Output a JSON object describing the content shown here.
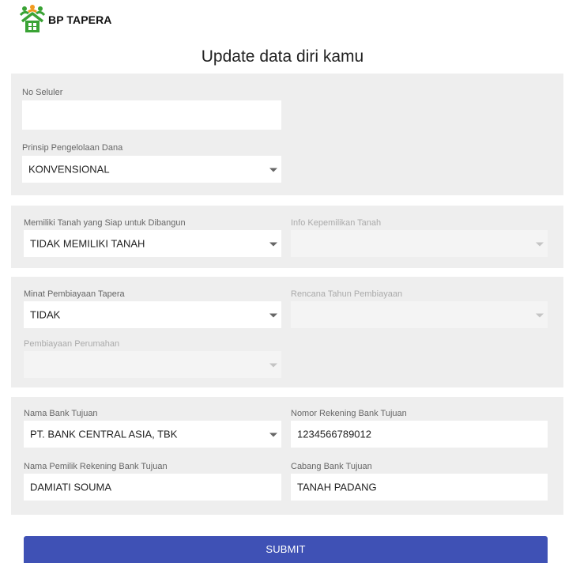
{
  "app": {
    "brand": "BP TAPERA",
    "logo_icon": "house-people-icon",
    "accent_green": "#3aa335",
    "accent_orange": "#f29a1f"
  },
  "page": {
    "title": "Update data diri kamu"
  },
  "section1": {
    "phone": {
      "label": "No Seluler",
      "value": ""
    },
    "fund_principle": {
      "label": "Prinsip Pengelolaan Dana",
      "value": "KONVENSIONAL"
    }
  },
  "section2": {
    "land_ready": {
      "label": "Memiliki Tanah yang Siap untuk Dibangun",
      "value": "TIDAK MEMILIKI TANAH"
    },
    "land_info": {
      "label": "Info Kepemilikan Tanah",
      "value": ""
    }
  },
  "section3": {
    "financing_interest": {
      "label": "Minat Pembiayaan Tapera",
      "value": "TIDAK"
    },
    "financing_year": {
      "label": "Rencana Tahun Pembiayaan",
      "value": ""
    },
    "housing_financing": {
      "label": "Pembiayaan Perumahan",
      "value": ""
    }
  },
  "section4": {
    "bank_name": {
      "label": "Nama Bank Tujuan",
      "value": "PT. BANK CENTRAL ASIA, TBK"
    },
    "account_number": {
      "label": "Nomor Rekening Bank Tujuan",
      "value": "1234566789012"
    },
    "account_owner": {
      "label": "Nama Pemilik Rekening Bank Tujuan",
      "value": "DAMIATI SOUMA"
    },
    "bank_branch": {
      "label": "Cabang Bank Tujuan",
      "value": "TANAH PADANG"
    }
  },
  "actions": {
    "submit_label": "SUBMIT",
    "submit_color": "#3f51b5"
  }
}
